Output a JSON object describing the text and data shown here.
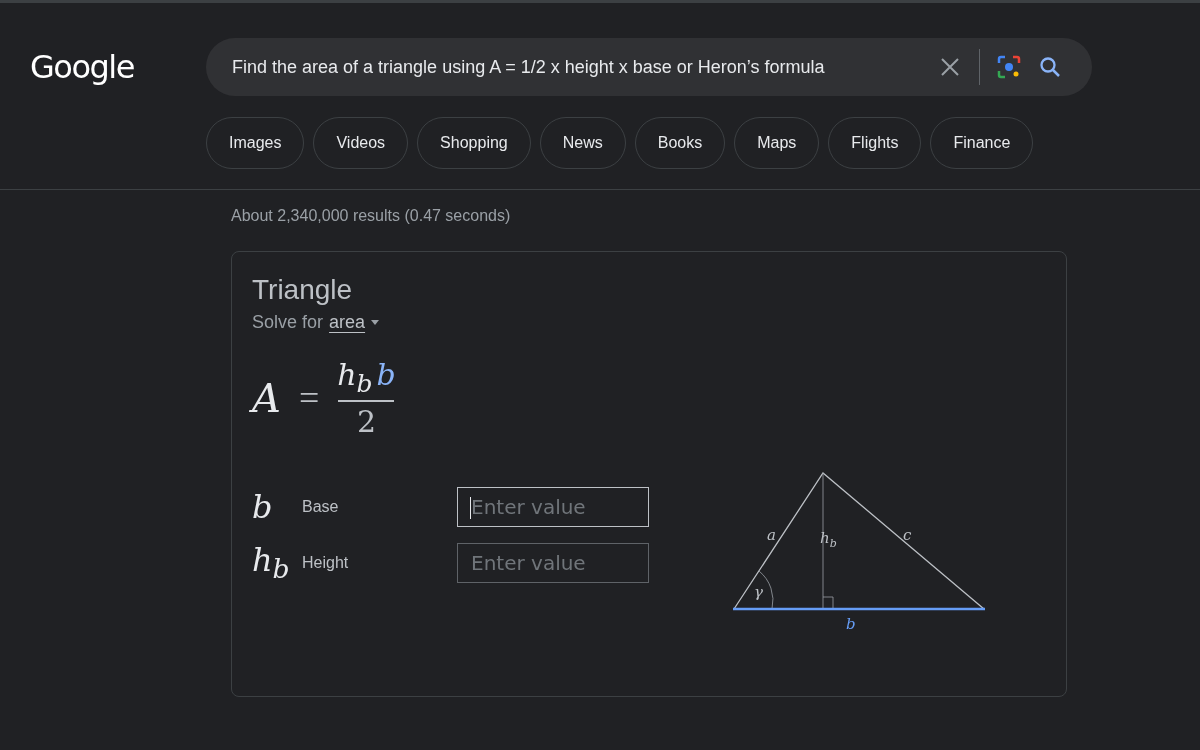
{
  "logo": "Google",
  "search": {
    "value": "Find the area of a triangle using A = 1/2 x height x base or Heron’s formula"
  },
  "chips": [
    {
      "label": "Images"
    },
    {
      "label": "Videos"
    },
    {
      "label": "Shopping"
    },
    {
      "label": "News"
    },
    {
      "label": "Books"
    },
    {
      "label": "Maps"
    },
    {
      "label": "Flights"
    },
    {
      "label": "Finance"
    }
  ],
  "result_stats": "About 2,340,000 results (0.47 seconds)",
  "calculator": {
    "title": "Triangle",
    "solve_for_label": "Solve for",
    "solve_for_value": "area",
    "formula": {
      "lhs": "A",
      "equals": "=",
      "numerator": "h$_{b}$",
      "numerator_var": "b",
      "denominator": "2"
    },
    "inputs": [
      {
        "symbol": "b",
        "label": "Base",
        "placeholder": "Enter value",
        "focused": true
      },
      {
        "symbol": "h$_{b}$",
        "label": "Height",
        "placeholder": "Enter value",
        "focused": false
      }
    ],
    "diagram_labels": {
      "side_a": "a",
      "height": "h$_{b}$",
      "side_c": "c",
      "angle": "γ",
      "base": "b"
    }
  }
}
